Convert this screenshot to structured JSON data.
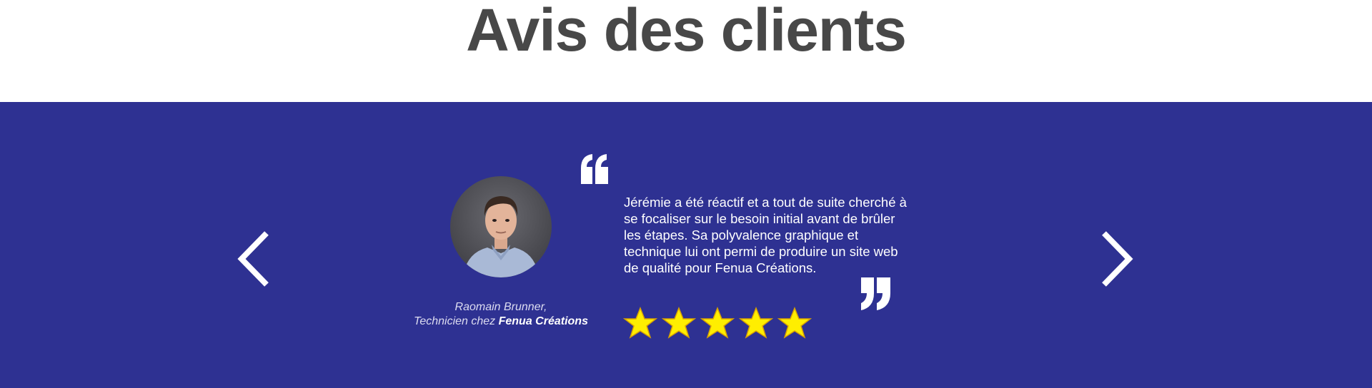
{
  "section": {
    "title": "Avis des clients"
  },
  "colors": {
    "band_background": "#2e3192",
    "title_color": "#484848",
    "star_fill": "#ffee00",
    "star_outline": "#d9a300",
    "text_color": "#ffffff"
  },
  "carousel": {
    "prev_icon": "chevron-left-icon",
    "next_icon": "chevron-right-icon"
  },
  "testimonial": {
    "avatar_icon": "person-portrait",
    "author_name": "Raomain Brunner,",
    "author_role_prefix": "Technicien chez ",
    "author_company": "Fenua Créations",
    "quote": "Jérémie a été réactif et a tout de suite cherché à se focaliser sur le besoin initial avant de brûler les étapes. Sa polyvalence graphique et technique lui ont permi de produire un site web de qualité pour Fenua Créations.",
    "rating": 5,
    "rating_max": 5
  }
}
